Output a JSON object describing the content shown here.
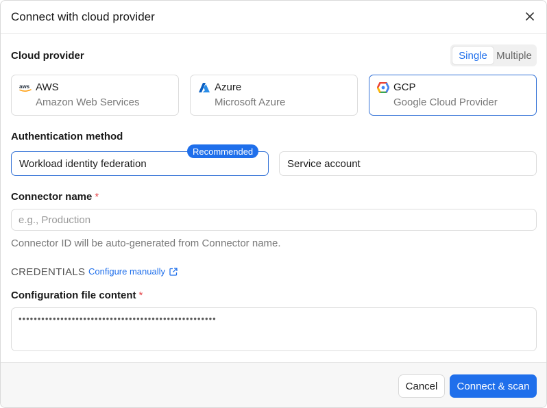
{
  "dialog": {
    "title": "Connect with cloud provider",
    "close_icon": "close-icon"
  },
  "cloud_provider": {
    "label": "Cloud provider",
    "mode": {
      "options": [
        "Single",
        "Multiple"
      ],
      "selected": "Single"
    },
    "providers": [
      {
        "name": "AWS",
        "subtitle": "Amazon Web Services",
        "icon": "aws-logo-icon"
      },
      {
        "name": "Azure",
        "subtitle": "Microsoft Azure",
        "icon": "azure-logo-icon"
      },
      {
        "name": "GCP",
        "subtitle": "Google Cloud Provider",
        "icon": "gcp-logo-icon"
      }
    ],
    "selected": "GCP"
  },
  "auth": {
    "label": "Authentication method",
    "options": [
      {
        "label": "Workload identity federation",
        "badge": "Recommended"
      },
      {
        "label": "Service account"
      }
    ],
    "selected": "Workload identity federation"
  },
  "connector": {
    "label": "Connector name",
    "required_mark": "*",
    "placeholder": "e.g., Production",
    "value": "",
    "help": "Connector ID will be auto-generated from Connector name."
  },
  "credentials": {
    "section_label": "CREDENTIALS",
    "configure_link": "Configure manually",
    "link_icon": "external-link-icon",
    "file_label": "Configuration file content",
    "required_mark": "*",
    "file_value": "••••••••••••••••••••••••••••••••••••••••••••••••••••"
  },
  "footer": {
    "cancel_label": "Cancel",
    "submit_label": "Connect & scan"
  },
  "colors": {
    "accent": "#1f6feb",
    "required": "#e5484d"
  }
}
